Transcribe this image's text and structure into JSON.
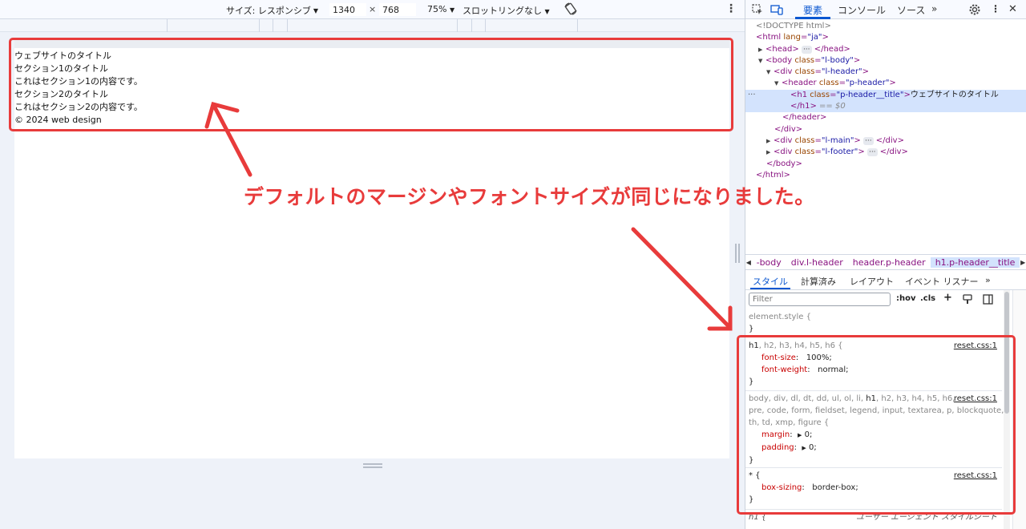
{
  "device_toolbar": {
    "size_label": "サイズ: レスポンシブ",
    "width": "1340",
    "height": "768",
    "times": "×",
    "zoom": "75%",
    "throttle": "スロットリングなし"
  },
  "page": {
    "lines": [
      "ウェブサイトのタイトル",
      "セクション1のタイトル",
      "これはセクション1の内容です。",
      "セクション2のタイトル",
      "これはセクション2の内容です。",
      "© 2024 web design"
    ]
  },
  "annotation": {
    "text": "デフォルトのマージンやフォントサイズが同じになりました。",
    "color": "#e83b3b"
  },
  "devtools": {
    "tabs": [
      "要素",
      "コンソール",
      "ソース"
    ],
    "more_tabs": "»",
    "dom": {
      "doctype": "<!DOCTYPE html>",
      "html_open": "html",
      "html_attr": "lang",
      "html_val": "\"ja\"",
      "head": "head",
      "head_close": "</head>",
      "body": "body",
      "body_attr": "class",
      "body_val": "\"l-body\"",
      "div_header": "div",
      "div_header_val": "\"l-header\"",
      "header": "header",
      "header_val": "\"p-header\"",
      "h1": "h1",
      "h1_val": "\"p-header__title\"",
      "h1_text": "ウェブサイトのタイトル",
      "h1_close": "</h1>",
      "eq0": "== $0",
      "header_close": "</header>",
      "div_close": "</div>",
      "div_main_val": "\"l-main\"",
      "div_footer_val": "\"l-footer\"",
      "body_close": "</body>",
      "html_close": "</html>",
      "ellipsis": "···"
    },
    "breadcrumbs": [
      "-body",
      "div.l-header",
      "header.p-header",
      "h1.p-header__title"
    ],
    "sub_tabs": [
      "スタイル",
      "計算済み",
      "レイアウト",
      "イベント リスナー"
    ],
    "filter_placeholder": "Filter",
    "filter_hov": ":hov",
    "filter_cls": ".cls",
    "rules": {
      "element_style": "element.style {",
      "close": "}",
      "r1_selector_main": "h1",
      "r1_selector_rest": ", h2, h3, h4, h5, h6 {",
      "r1_src": "reset.css:1",
      "r1_p1_name": "font-size",
      "r1_p1_val": "100%;",
      "r1_p2_name": "font-weight",
      "r1_p2_val": "normal;",
      "r2_sel_a": "body, div, dl, dt, dd, ul, ol, li, ",
      "r2_sel_h1": "h1",
      "r2_sel_b": ", h2, h3, h4, h5, h6,",
      "r2_sel_c": "pre, code, form, fieldset, legend, input, textarea, p, blockquote,",
      "r2_sel_d": "th, td, xmp, figure {",
      "r2_src": "reset.css:1",
      "r2_p1_name": "margin",
      "r2_p1_val": "0;",
      "r2_p2_name": "padding",
      "r2_p2_val": "0;",
      "r3_selector": "* {",
      "r3_src": "reset.css:1",
      "r3_p1_name": "box-sizing",
      "r3_p1_val": "border-box;",
      "r4_selector": "h1 {",
      "r4_src": "ユーザー エージェント スタイルシート"
    }
  },
  "colors": {
    "accent": "#0b57d0",
    "annotation_red": "#e83b3b",
    "tag": "#881280",
    "attr": "#994500",
    "prop_name": "#c80000"
  }
}
